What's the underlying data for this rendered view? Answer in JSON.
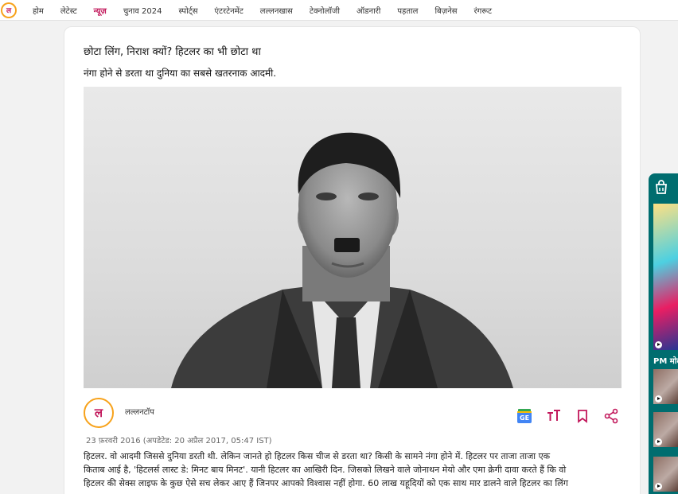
{
  "nav": {
    "logo_text": "ल",
    "items": [
      {
        "label": "होम"
      },
      {
        "label": "लेटेस्ट"
      },
      {
        "label": "न्यूज़",
        "active": true
      },
      {
        "label": "चुनाव 2024"
      },
      {
        "label": "स्पोर्ट्स"
      },
      {
        "label": "एंटरटेनमेंट"
      },
      {
        "label": "लल्लनखास"
      },
      {
        "label": "टेक्नोलॉजी"
      },
      {
        "label": "ऑडनारी"
      },
      {
        "label": "पड़ताल"
      },
      {
        "label": "बिज़नेस"
      },
      {
        "label": "रंगरूट"
      }
    ]
  },
  "article": {
    "title": "छोटा लिंग, निराश क्यों? हिटलर का भी छोटा था",
    "subtitle": "नंगा होने से डरता था दुनिया का सबसे खतरनाक आदमी.",
    "author": "लल्लनटॉप",
    "avatar_text": "ल",
    "date": "23 फ़रवरी 2016 (अपडेटेड: 20 अप्रैल 2017, 05:47 IST)",
    "body_lines": [
      "हिटलर. वो आदमी जिससे दुनिया डरती थी. लेकिन जानते हो हिटलर किस चीज से डरता था? किसी के सामने नंगा होने में. हिटलर पर ताजा ताजा एक",
      "किताब आई है, 'हिटलर्स लास्ट डे: मिनट बाय मिनट'. यानी हिटलर का आखिरी दिन. जिसको लिखने वाले जोनाथन मेयो और एमा क्रेगी दावा करते हैं कि वो",
      "हिटलर की सेक्स लाइफ के कुछ ऐसे सच लेकर आए हैं जिनपर आपको विश्वास नहीं होगा. 60 लाख यहूदियों को एक साथ मार डालने वाले हिटलर का लिंग"
    ]
  },
  "actions": [
    {
      "icon": "google-news-icon",
      "color": "#1a73e8"
    },
    {
      "icon": "text-size-icon",
      "color": "#c2185b"
    },
    {
      "icon": "bookmark-icon",
      "color": "#c2185b"
    },
    {
      "icon": "share-icon",
      "color": "#c2185b"
    }
  ],
  "sidebar": {
    "headline": "PM मोद",
    "icon": "shopping-bag-icon"
  },
  "colors": {
    "accent": "#c2185b",
    "brand_orange": "#f7a21b",
    "sidebar_bg": "#006d6f"
  }
}
